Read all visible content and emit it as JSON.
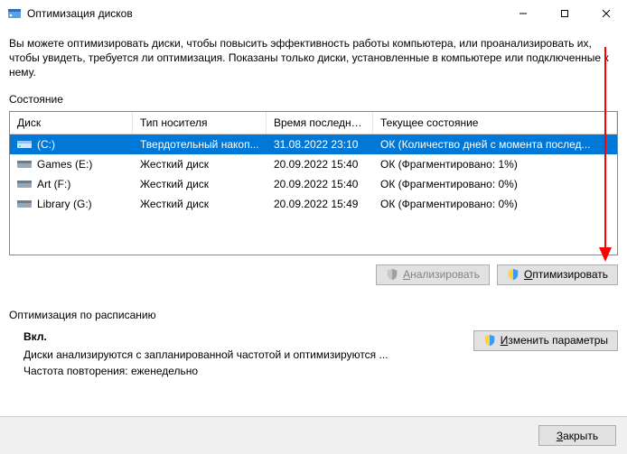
{
  "window": {
    "title": "Оптимизация дисков"
  },
  "description": "Вы можете оптимизировать диски, чтобы повысить эффективность работы  компьютера, или проанализировать их, чтобы увидеть, требуется ли оптимизация. Показаны только диски, установленные в компьютере или подключенные к нему.",
  "state_label": "Состояние",
  "columns": {
    "disk": "Диск",
    "media": "Тип носителя",
    "last": "Время последнег...",
    "status": "Текущее состояние"
  },
  "rows": [
    {
      "name": "(C:)",
      "media": "Твердотельный накоп...",
      "last": "31.08.2022 23:10",
      "status": "ОК (Количество дней с момента послед...",
      "selected": true,
      "ssd": true
    },
    {
      "name": "Games (E:)",
      "media": "Жесткий диск",
      "last": "20.09.2022 15:40",
      "status": "ОК (Фрагментировано: 1%)",
      "selected": false,
      "ssd": false
    },
    {
      "name": "Art (F:)",
      "media": "Жесткий диск",
      "last": "20.09.2022 15:40",
      "status": "ОК (Фрагментировано: 0%)",
      "selected": false,
      "ssd": false
    },
    {
      "name": "Library (G:)",
      "media": "Жесткий диск",
      "last": "20.09.2022 15:49",
      "status": "ОК (Фрагментировано: 0%)",
      "selected": false,
      "ssd": false
    }
  ],
  "buttons": {
    "analyze": "Анализировать",
    "optimize": "Оптимизировать",
    "change_settings": "Изменить параметры",
    "close": "Закрыть"
  },
  "schedule": {
    "header": "Оптимизация по расписанию",
    "on": "Вкл.",
    "line1": "Диски анализируются с запланированной частотой и оптимизируются ...",
    "line2": "Частота повторения: еженедельно"
  }
}
